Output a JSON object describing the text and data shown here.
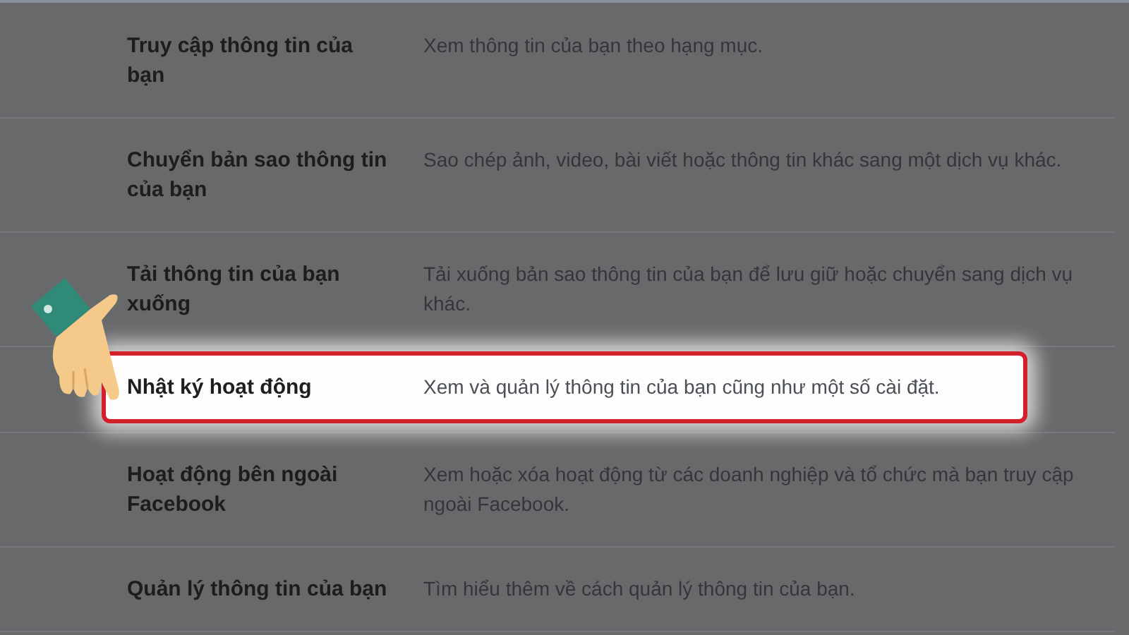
{
  "settings": [
    {
      "title": "Truy cập thông tin của bạn",
      "description": "Xem thông tin của bạn theo hạng mục.",
      "selected": false
    },
    {
      "title": "Chuyển bản sao thông tin của bạn",
      "description": "Sao chép ảnh, video, bài viết hoặc thông tin khác sang một dịch vụ khác.",
      "selected": false
    },
    {
      "title": "Tải thông tin của bạn xuống",
      "description": "Tải xuống bản sao thông tin của bạn để lưu giữ hoặc chuyển sang dịch vụ khác.",
      "selected": false
    },
    {
      "title": "Nhật ký hoạt động",
      "description": "Xem và quản lý thông tin của bạn cũng như một số cài đặt.",
      "selected": true
    },
    {
      "title": "Hoạt động bên ngoài Facebook",
      "description": "Xem hoặc xóa hoạt động từ các doanh nghiệp và tổ chức mà bạn truy cập ngoài Facebook.",
      "selected": false
    },
    {
      "title": "Quản lý thông tin của bạn",
      "description": "Tìm hiểu thêm về cách quản lý thông tin của bạn.",
      "selected": false
    }
  ]
}
